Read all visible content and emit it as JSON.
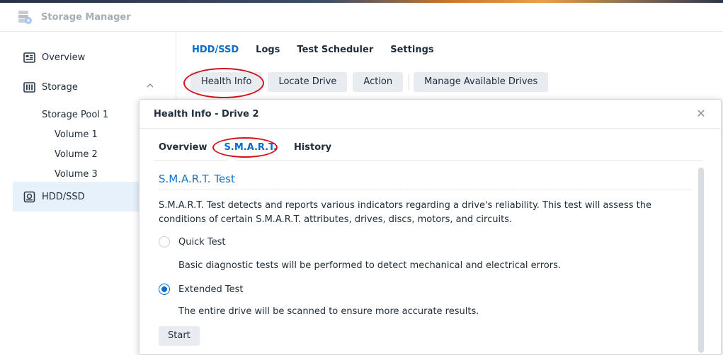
{
  "app": {
    "title": "Storage Manager"
  },
  "sidebar": {
    "overview": "Overview",
    "storage": "Storage",
    "pool": "Storage Pool 1",
    "volumes": [
      "Volume 1",
      "Volume 2",
      "Volume 3"
    ],
    "hdd": "HDD/SSD"
  },
  "tabs": [
    "HDD/SSD",
    "Logs",
    "Test Scheduler",
    "Settings"
  ],
  "toolbar": {
    "health_info": "Health Info",
    "locate_drive": "Locate Drive",
    "action": "Action",
    "manage": "Manage Available Drives"
  },
  "dialog": {
    "title": "Health Info - Drive 2",
    "tabs": [
      "Overview",
      "S.M.A.R.T.",
      "History"
    ],
    "section_title": "S.M.A.R.T. Test",
    "description": "S.M.A.R.T. Test detects and reports various indicators regarding a drive's reliability. This test will assess the conditions of certain S.M.A.R.T. attributes, drives, discs, motors, and circuits.",
    "quick_label": "Quick Test",
    "quick_hint": "Basic diagnostic tests will be performed to detect mechanical and electrical errors.",
    "extended_label": "Extended Test",
    "extended_hint": "The entire drive will be scanned to ensure more accurate results.",
    "selected": "Extended Test",
    "start": "Start"
  },
  "colors": {
    "accent": "#0a6cc8",
    "highlight_ring": "#d5131c",
    "active_nav_bg": "#e6f1fb"
  }
}
